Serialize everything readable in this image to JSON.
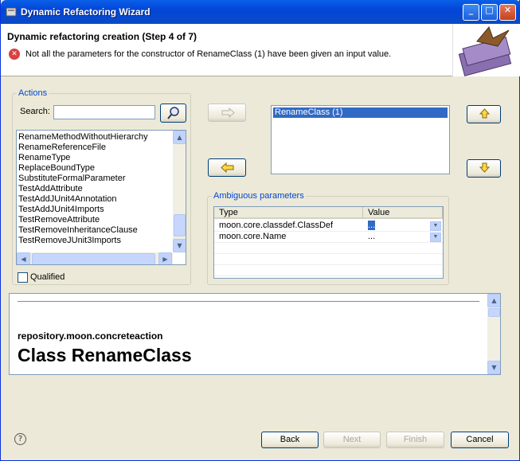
{
  "window": {
    "title": "Dynamic Refactoring Wizard",
    "minimize": "_",
    "maximize": "□",
    "close": "✕"
  },
  "header": {
    "heading": "Dynamic refactoring creation (Step 4 of 7)",
    "error_message": "Not all the parameters for the constructor of RenameClass (1) have been given an input value.",
    "error_glyph": "✕"
  },
  "actions": {
    "group_label": "Actions",
    "search_label": "Search:",
    "search_value": "",
    "items": [
      "RenameMethodWithoutHierarchy",
      "RenameReferenceFile",
      "RenameType",
      "ReplaceBoundType",
      "SubstituteFormalParameter",
      "TestAddAttribute",
      "TestAddJUnit4Annotation",
      "TestAddJUnit4Imports",
      "TestRemoveAttribute",
      "TestRemoveInheritanceClause",
      "TestRemoveJUnit3Imports"
    ],
    "qualified_label": "Qualified",
    "qualified_checked": false
  },
  "selected": {
    "items": [
      "RenameClass (1)"
    ]
  },
  "ambiguous": {
    "group_label": "Ambiguous parameters",
    "col_type": "Type",
    "col_value": "Value",
    "rows": [
      {
        "type": "moon.core.classdef.ClassDef",
        "value": "..."
      },
      {
        "type": "moon.core.Name",
        "value": "..."
      }
    ]
  },
  "doc": {
    "package": "repository.moon.concreteaction",
    "class_title": "Class RenameClass"
  },
  "footer": {
    "help": "?",
    "back": "Back",
    "next": "Next",
    "finish": "Finish",
    "cancel": "Cancel"
  },
  "colors": {
    "accent": "#316ac5",
    "title_bar": "#0a5fe8",
    "error": "#d94141"
  }
}
